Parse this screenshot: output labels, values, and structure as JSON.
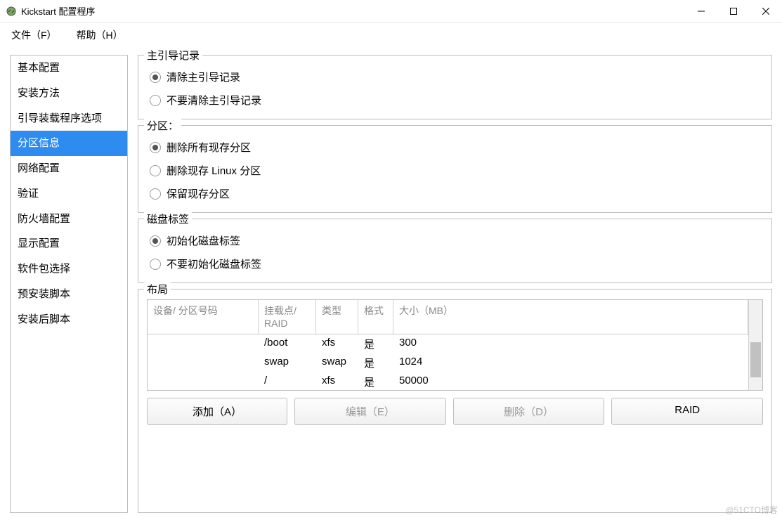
{
  "window": {
    "title": "Kickstart 配置程序"
  },
  "menu": {
    "file": "文件（F）",
    "help": "帮助（H）"
  },
  "sidebar": {
    "items": [
      "基本配置",
      "安装方法",
      "引导装载程序选项",
      "分区信息",
      "网络配置",
      "验证",
      "防火墙配置",
      "显示配置",
      "软件包选择",
      "预安装脚本",
      "安装后脚本"
    ],
    "selected_index": 3
  },
  "groups": {
    "mbr": {
      "title": "主引导记录",
      "options": [
        "清除主引导记录",
        "不要清除主引导记录"
      ],
      "selected": 0
    },
    "partition": {
      "title": "分区：",
      "options": [
        "删除所有现存分区",
        "删除现存 Linux 分区",
        "保留现存分区"
      ],
      "selected": 0
    },
    "disklabel": {
      "title": "磁盘标签",
      "options": [
        "初始化磁盘标签",
        "不要初始化磁盘标签"
      ],
      "selected": 0
    },
    "layout": {
      "title": "布局",
      "headers": {
        "device": "设备/\n分区号码",
        "mount": "挂载点/\nRAID",
        "type": "类型",
        "format": "格式",
        "size": "大小（MB）"
      },
      "rows": [
        {
          "device": "",
          "mount": "/boot",
          "type": "xfs",
          "format": "是",
          "size": "300"
        },
        {
          "device": "",
          "mount": "swap",
          "type": "swap",
          "format": "是",
          "size": "1024"
        },
        {
          "device": "",
          "mount": "/",
          "type": "xfs",
          "format": "是",
          "size": "50000"
        }
      ],
      "buttons": {
        "add": "添加（A）",
        "edit": "编辑（E）",
        "delete": "删除（D）",
        "raid": "RAID"
      }
    }
  },
  "watermark": "@51CTO博客"
}
